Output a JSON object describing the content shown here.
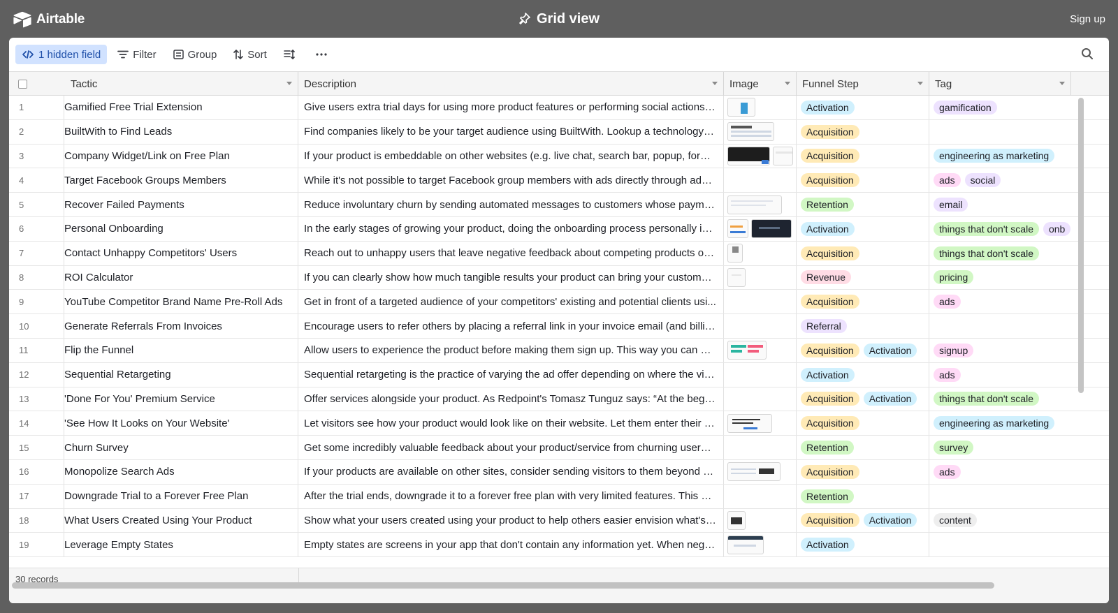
{
  "app": {
    "name": "Airtable",
    "view_title": "Grid view",
    "signup_label": "Sign up"
  },
  "toolbar": {
    "hidden_fields": "1 hidden field",
    "filter": "Filter",
    "group": "Group",
    "sort": "Sort"
  },
  "columns": {
    "tactic": "Tactic",
    "description": "Description",
    "image": "Image",
    "funnel": "Funnel Step",
    "tag": "Tag"
  },
  "colors": {
    "Activation": "#d0f0fd",
    "Acquisition": "#ffeab6",
    "Retention": "#d1f7c4",
    "Revenue": "#ffdce5",
    "Referral": "#ede2fe"
  },
  "rows": [
    {
      "n": "1",
      "tactic": "Gamified Free Trial Extension",
      "desc": "Give users extra trial days for using more product features or performing social actions e...",
      "img": 1,
      "funnel": [
        "Activation"
      ],
      "tags": [
        [
          "gamification",
          "purple"
        ]
      ]
    },
    {
      "n": "2",
      "tactic": "BuiltWith to Find Leads",
      "desc": "Find companies likely to be your target audience using BuiltWith. Lookup a technology a...",
      "img": 2,
      "funnel": [
        "Acquisition"
      ],
      "tags": []
    },
    {
      "n": "3",
      "tactic": "Company Widget/Link on Free Plan",
      "desc": "If your product is embeddable on other websites (e.g. live chat, search bar, popup, form ...",
      "img": 3,
      "funnel": [
        "Acquisition"
      ],
      "tags": [
        [
          "engineering as marketing",
          "blue"
        ]
      ]
    },
    {
      "n": "4",
      "tactic": "Target Facebook Groups Members",
      "desc": "While it's not possible to target Facebook group members with ads directly through ads ...",
      "img": 0,
      "funnel": [
        "Acquisition"
      ],
      "tags": [
        [
          "ads",
          "pink"
        ],
        [
          "social",
          "purple"
        ]
      ]
    },
    {
      "n": "5",
      "tactic": "Recover Failed Payments",
      "desc": "Reduce involuntary churn by sending automated messages to customers whose paymen...",
      "img": 5,
      "funnel": [
        "Retention"
      ],
      "tags": [
        [
          "email",
          "purple"
        ]
      ]
    },
    {
      "n": "6",
      "tactic": "Personal Onboarding",
      "desc": "In the early stages of growing your product, doing the onboarding process personally is ...",
      "img": 6,
      "funnel": [
        "Activation"
      ],
      "tags": [
        [
          "things that don't scale",
          "green"
        ],
        [
          "onb",
          "purple"
        ]
      ]
    },
    {
      "n": "7",
      "tactic": "Contact Unhappy Competitors' Users",
      "desc": "Reach out to unhappy users that leave negative feedback about competing products on ...",
      "img": 7,
      "funnel": [
        "Acquisition"
      ],
      "tags": [
        [
          "things that don't scale",
          "green"
        ]
      ]
    },
    {
      "n": "8",
      "tactic": "ROI Calculator",
      "desc": "If you can clearly show how much tangible results your product can bring your customer...",
      "img": 8,
      "funnel": [
        "Revenue"
      ],
      "tags": [
        [
          "pricing",
          "green"
        ]
      ]
    },
    {
      "n": "9",
      "tactic": "YouTube Competitor Brand Name Pre-Roll Ads",
      "desc": "Get in front of a targeted audience of your competitors' existing and potential clients usi...",
      "img": 0,
      "funnel": [
        "Acquisition"
      ],
      "tags": [
        [
          "ads",
          "pink"
        ]
      ]
    },
    {
      "n": "10",
      "tactic": "Generate Referrals From Invoices",
      "desc": "Encourage users to refer others by placing a referral link in your invoice email (and billin...",
      "img": 0,
      "funnel": [
        "Referral"
      ],
      "tags": []
    },
    {
      "n": "11",
      "tactic": "Flip the Funnel",
      "desc": "Allow users to experience the product before making them sign up. This way you can ge...",
      "img": 11,
      "funnel": [
        "Acquisition",
        "Activation"
      ],
      "tags": [
        [
          "signup",
          "pink"
        ]
      ]
    },
    {
      "n": "12",
      "tactic": "Sequential Retargeting",
      "desc": "Sequential retargeting is the practice of varying the ad offer depending on where the visi...",
      "img": 0,
      "funnel": [
        "Activation"
      ],
      "tags": [
        [
          "ads",
          "pink"
        ]
      ]
    },
    {
      "n": "13",
      "tactic": "'Done For You' Premium Service",
      "desc": "Offer services alongside your product. As Redpoint's Tomasz Tunguz says: “At the begin...",
      "img": 0,
      "funnel": [
        "Acquisition",
        "Activation"
      ],
      "tags": [
        [
          "things that don't scale",
          "green"
        ]
      ]
    },
    {
      "n": "14",
      "tactic": "'See How It Looks on Your Website'",
      "desc": "Let visitors see how your product would look like on their website. Let them enter their w...",
      "img": 14,
      "funnel": [
        "Acquisition"
      ],
      "tags": [
        [
          "engineering as marketing",
          "blue"
        ]
      ]
    },
    {
      "n": "15",
      "tactic": "Churn Survey",
      "desc": "Get some incredibly valuable feedback about your product/service from churning users. ...",
      "img": 0,
      "funnel": [
        "Retention"
      ],
      "tags": [
        [
          "survey",
          "green"
        ]
      ]
    },
    {
      "n": "16",
      "tactic": "Monopolize Search Ads",
      "desc": "If your products are available on other sites, consider sending visitors to them beyond y...",
      "img": 16,
      "funnel": [
        "Acquisition"
      ],
      "tags": [
        [
          "ads",
          "pink"
        ]
      ]
    },
    {
      "n": "17",
      "tactic": "Downgrade Trial to a Forever Free Plan",
      "desc": "After the trial ends, downgrade it to a forever free plan with very limited features. This w...",
      "img": 0,
      "funnel": [
        "Retention"
      ],
      "tags": []
    },
    {
      "n": "18",
      "tactic": "What Users Created Using Your Product",
      "desc": "Show what your users created using your product to help others easier envision what's ...",
      "img": 18,
      "funnel": [
        "Acquisition",
        "Activation"
      ],
      "tags": [
        [
          "content",
          "gray"
        ]
      ]
    },
    {
      "n": "19",
      "tactic": "Leverage Empty States",
      "desc": "Empty states are screens in your app that don't contain any information yet. When negle...",
      "img": 19,
      "funnel": [
        "Activation"
      ],
      "tags": []
    }
  ],
  "footer": {
    "records": "30 records"
  }
}
